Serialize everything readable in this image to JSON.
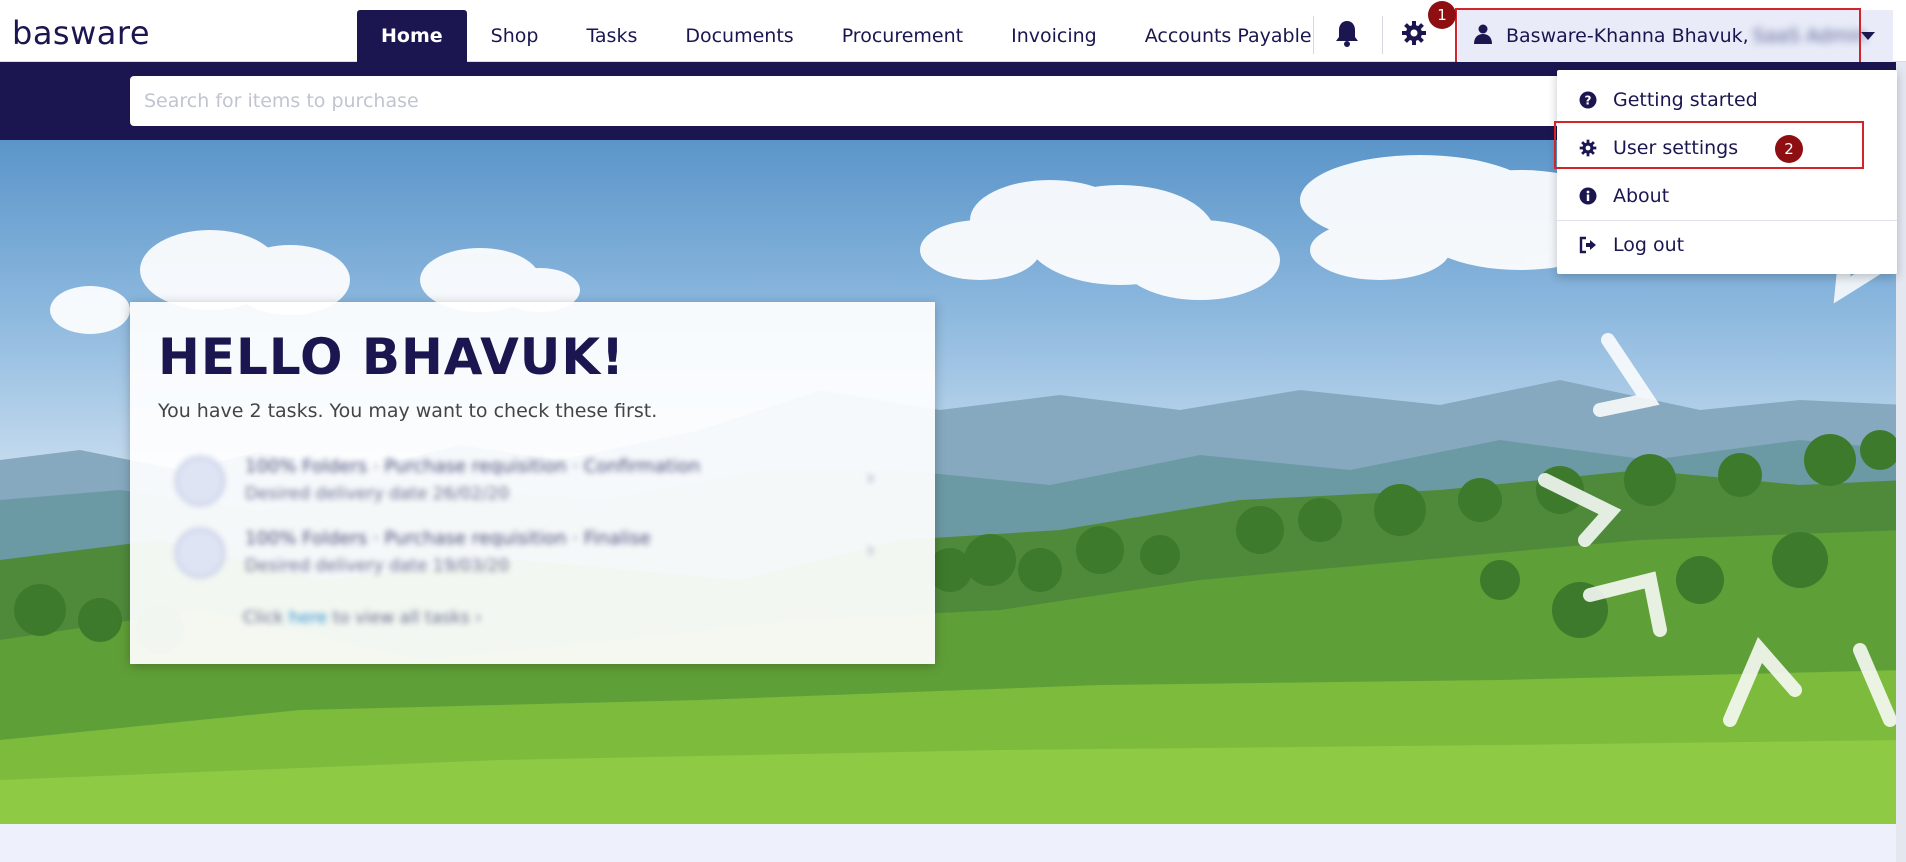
{
  "brand": {
    "logo_text": "basware"
  },
  "nav": {
    "items": [
      {
        "label": "Home",
        "active": true
      },
      {
        "label": "Shop",
        "active": false
      },
      {
        "label": "Tasks",
        "active": false
      },
      {
        "label": "Documents",
        "active": false
      },
      {
        "label": "Procurement",
        "active": false
      },
      {
        "label": "Invoicing",
        "active": false
      },
      {
        "label": "Accounts Payable",
        "active": false
      }
    ],
    "icons": [
      "bell-icon",
      "gear-icon"
    ]
  },
  "user": {
    "name": "Basware-Khanna Bhavuk,",
    "role_blurred": "SaaS Admin"
  },
  "search": {
    "placeholder": "Search for items to purchase",
    "value": ""
  },
  "welcome": {
    "title": "HELLO BHAVUK!",
    "subtitle": "You have 2 tasks. You may want to check these first.",
    "tasks": [
      {
        "line1": "100% Folders · Purchase requisition · Confirmation",
        "line2": "Desired delivery date 26/02/20"
      },
      {
        "line1": "100% Folders · Purchase requisition · Finalise",
        "line2": "Desired delivery date 19/03/20"
      }
    ],
    "view_all_prefix": "Click",
    "view_all_link": "here",
    "view_all_suffix": "to view all tasks ›"
  },
  "user_menu": {
    "items": [
      {
        "label": "Getting started",
        "icon": "question-circle-icon"
      },
      {
        "label": "User settings",
        "icon": "gear-icon"
      },
      {
        "label": "About",
        "icon": "info-circle-icon"
      },
      {
        "label": "Log out",
        "icon": "sign-out-icon"
      }
    ]
  },
  "annotations": {
    "step1": "1",
    "step2": "2",
    "highlight_color": "#d3242a",
    "badge_color": "#8e0f12"
  },
  "colors": {
    "brand_navy": "#1b1650",
    "search_band": "#1b1650",
    "menu_bg": "#e9ecf8"
  }
}
